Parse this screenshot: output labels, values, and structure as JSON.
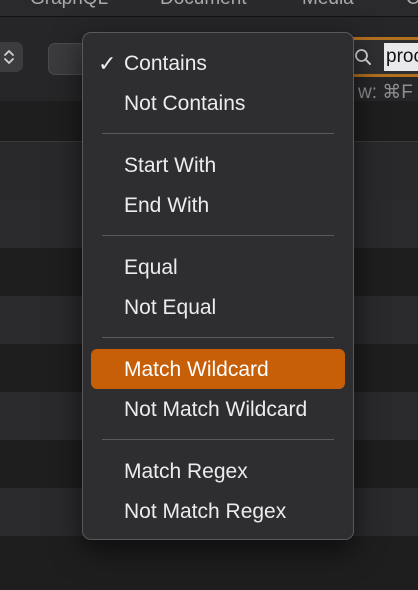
{
  "tabs": [
    "GraphQL",
    "Document",
    "Media",
    "C"
  ],
  "toolbar": {
    "search_value": "proc",
    "shortcut_hint": "w: ⌘F",
    "icons": {
      "stepper": "up-down-chevrons-icon",
      "search": "magnifier-icon"
    }
  },
  "menu": {
    "selected": "Contains",
    "highlighted": "Match Wildcard",
    "accent_color": "#c75f08",
    "groups": [
      [
        "Contains",
        "Not Contains"
      ],
      [
        "Start With",
        "End With"
      ],
      [
        "Equal",
        "Not Equal"
      ],
      [
        "Match Wildcard",
        "Not Match Wildcard"
      ],
      [
        "Match Regex",
        "Not Match Regex"
      ]
    ],
    "checkmark": "✓"
  }
}
